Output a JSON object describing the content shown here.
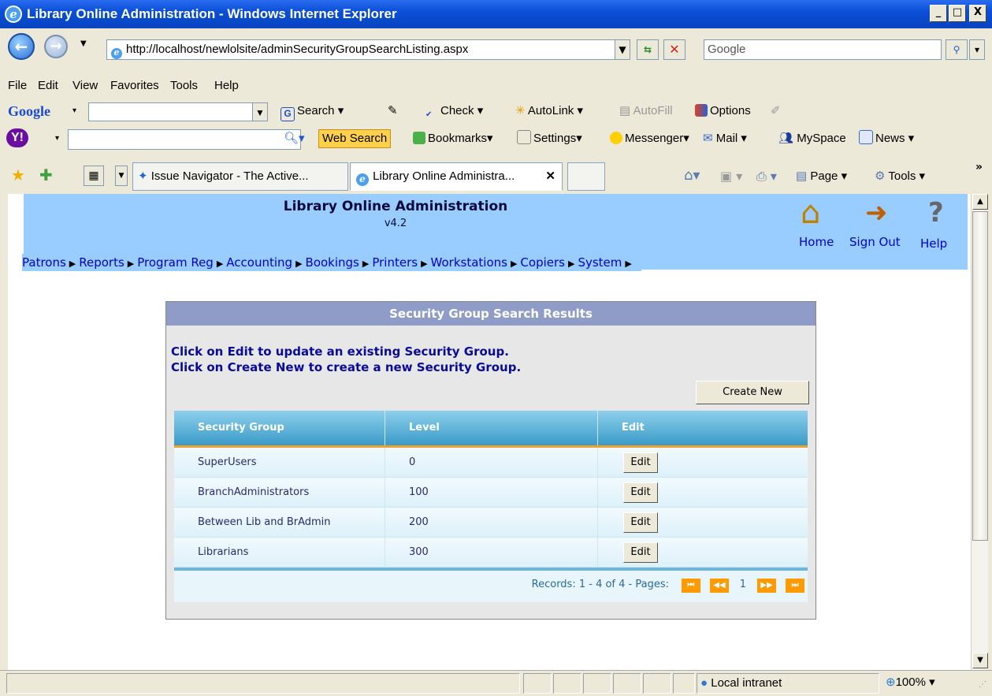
{
  "window": {
    "title": "Library Online Administration - Windows Internet Explorer",
    "min_label": "_",
    "max_label": "□",
    "close_label": "X"
  },
  "address_bar": {
    "url": "http://localhost/newlolsite/adminSecurityGroupSearchListing.aspx",
    "search_placeholder": "Google"
  },
  "menu": [
    "File",
    "Edit",
    "View",
    "Favorites",
    "Tools",
    "Help"
  ],
  "google_toolbar": {
    "logo": "Google",
    "search_label": "Search",
    "check_label": "Check",
    "autolink_label": "AutoLink",
    "autofill_label": "AutoFill",
    "options_label": "Options"
  },
  "yahoo_toolbar": {
    "logo": "Y!",
    "web_search_label": "Web Search",
    "bookmarks_label": "Bookmarks",
    "settings_label": "Settings",
    "messenger_label": "Messenger",
    "mail_label": "Mail",
    "myspace_label": "MySpace",
    "news_label": "News"
  },
  "tabs": [
    {
      "label": "Issue Navigator - The Active..."
    },
    {
      "label": "Library Online Administra..."
    }
  ],
  "command_bar": {
    "page_label": "Page",
    "tools_label": "Tools"
  },
  "app": {
    "title": "Library Online Administration",
    "version": "v4.2",
    "home_label": "Home",
    "signout_label": "Sign Out",
    "help_label": "Help",
    "nav": [
      "Patrons",
      "Reports",
      "Program Reg",
      "Accounting",
      "Bookings",
      "Printers",
      "Workstations",
      "Copiers",
      "System"
    ]
  },
  "panel": {
    "title": "Security Group Search Results",
    "instruction1": "Click on Edit to update an existing Security Group.",
    "instruction2": "Click on Create New to create a new Security Group.",
    "create_new_label": "Create New",
    "columns": [
      "Security Group",
      "Level",
      "Edit"
    ],
    "rows": [
      {
        "group": "SuperUsers",
        "level": "0",
        "edit": "Edit"
      },
      {
        "group": "BranchAdministrators",
        "level": "100",
        "edit": "Edit"
      },
      {
        "group": "Between Lib and BrAdmin",
        "level": "200",
        "edit": "Edit"
      },
      {
        "group": "Librarians",
        "level": "300",
        "edit": "Edit"
      }
    ],
    "pager_text": "Records: 1 - 4 of 4 - Pages:",
    "current_page": "1"
  },
  "status": {
    "zone": "Local intranet",
    "zoom": "100%"
  },
  "colors": {
    "header_band": "#99ccff",
    "panel_head": "#8f9cc8",
    "grid_head": "#3a9ac7",
    "pager_button": "#ff9a00"
  }
}
